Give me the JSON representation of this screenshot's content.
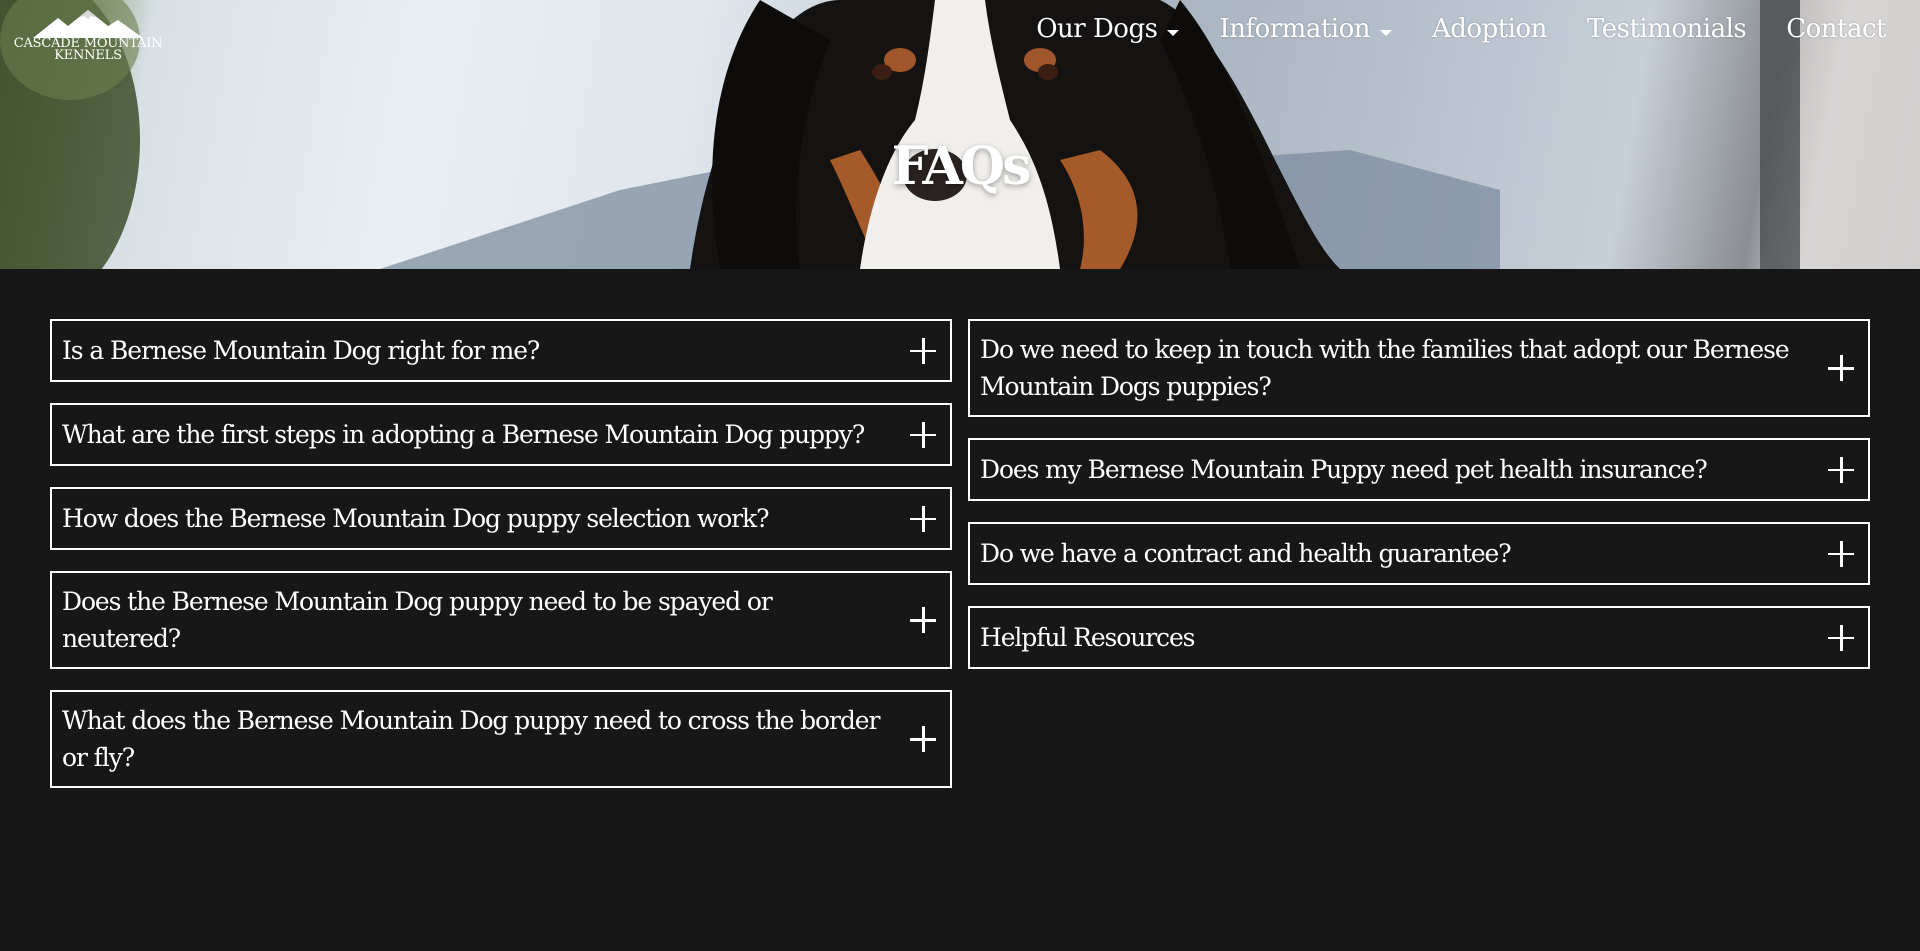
{
  "brand": {
    "logo_line1": "CASCADE MOUNTAIN",
    "logo_line2": "KENNELS"
  },
  "nav": {
    "items": [
      {
        "label": "Our Dogs",
        "dropdown": true
      },
      {
        "label": "Information",
        "dropdown": true
      },
      {
        "label": "Adoption",
        "dropdown": false
      },
      {
        "label": "Testimonials",
        "dropdown": false
      },
      {
        "label": "Contact",
        "dropdown": false
      }
    ]
  },
  "hero": {
    "title": "FAQs"
  },
  "faq": {
    "left": [
      {
        "question": "Is a Bernese Mountain Dog right for me?",
        "icon": "plus-icon"
      },
      {
        "question": "What are the first steps in adopting a Bernese Mountain Dog puppy?",
        "icon": "plus-icon"
      },
      {
        "question": "How does the Bernese Mountain Dog puppy selection work?",
        "icon": "plus-icon"
      },
      {
        "question": "Does the Bernese Mountain Dog puppy need to be spayed or neutered?",
        "icon": "plus-icon"
      },
      {
        "question": "What does the Bernese Mountain Dog puppy need to cross the border or fly?",
        "icon": "plus-icon"
      }
    ],
    "right": [
      {
        "question": "Do we need to keep in touch with the families that adopt our Bernese Mountain Dogs puppies?",
        "icon": "plus-icon"
      },
      {
        "question": "Does my Bernese Mountain Puppy need pet health insurance?",
        "icon": "plus-icon"
      },
      {
        "question": "Do we have a contract and health guarantee?",
        "icon": "plus-icon"
      },
      {
        "question": "Helpful Resources",
        "icon": "plus-icon"
      }
    ]
  },
  "colors": {
    "background": "#171717",
    "text": "#ffffff",
    "border": "#ffffff"
  }
}
